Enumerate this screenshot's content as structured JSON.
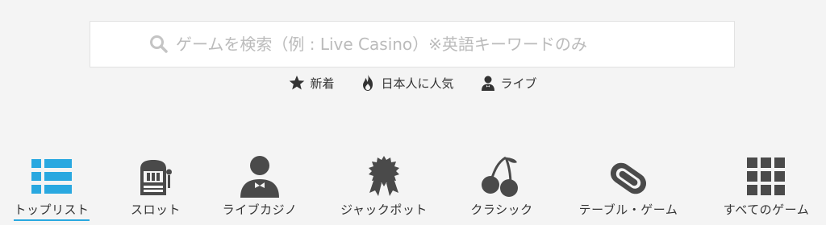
{
  "search": {
    "placeholder": "ゲームを検索（例 : Live Casino）※英語キーワードのみ"
  },
  "quick_links": [
    {
      "label": "新着",
      "icon": "star-icon"
    },
    {
      "label": "日本人に人気",
      "icon": "flame-icon"
    },
    {
      "label": "ライブ",
      "icon": "dealer-person-icon"
    }
  ],
  "nav": [
    {
      "label": "トップリスト",
      "icon": "list-icon",
      "active": true
    },
    {
      "label": "スロット",
      "icon": "slot-machine-icon",
      "active": false
    },
    {
      "label": "ライブカジノ",
      "icon": "dealer-icon",
      "active": false
    },
    {
      "label": "ジャックポット",
      "icon": "jackpot-badge-icon",
      "active": false
    },
    {
      "label": "クラシック",
      "icon": "cherries-icon",
      "active": false
    },
    {
      "label": "テーブル・ゲーム",
      "icon": "table-game-icon",
      "active": false
    },
    {
      "label": "すべてのゲーム",
      "icon": "grid-icon",
      "active": false
    }
  ],
  "colors": {
    "active_accent": "#29a8e0",
    "icon_dark": "#4a4a4a",
    "background": "#f4f4f4"
  }
}
